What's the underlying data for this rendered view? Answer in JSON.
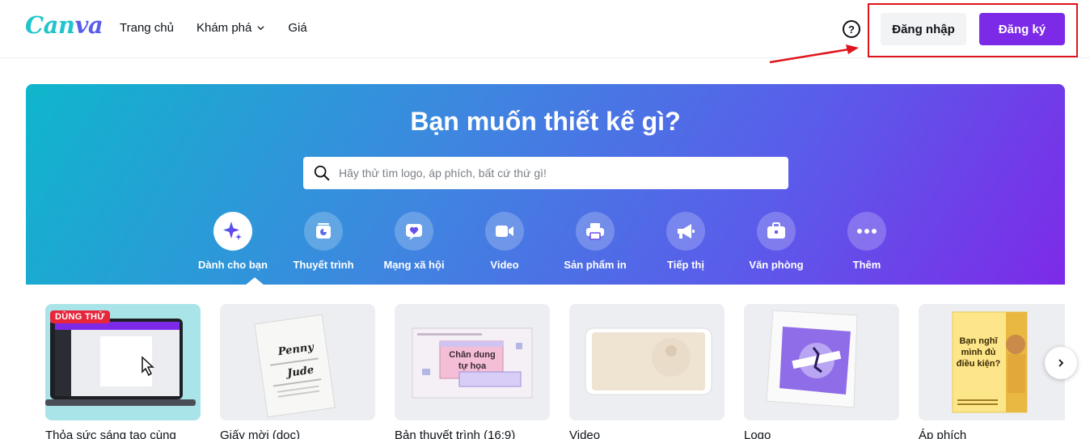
{
  "header": {
    "logo": "Canva",
    "nav": [
      {
        "label": "Trang chủ"
      },
      {
        "label": "Khám phá"
      },
      {
        "label": "Giá"
      }
    ],
    "help_icon": "question-circle-icon",
    "login_label": "Đăng nhập",
    "signup_label": "Đăng ký"
  },
  "hero": {
    "title": "Bạn muốn thiết kế gì?",
    "search_placeholder": "Hãy thử tìm logo, áp phích, bất cứ thứ gì!",
    "categories": [
      {
        "label": "Dành cho bạn",
        "icon": "sparkle-icon"
      },
      {
        "label": "Thuyết trình",
        "icon": "presentation-icon"
      },
      {
        "label": "Mạng xã hội",
        "icon": "heart-icon"
      },
      {
        "label": "Video",
        "icon": "video-camera-icon"
      },
      {
        "label": "Sản phẩm in",
        "icon": "printer-icon"
      },
      {
        "label": "Tiếp thị",
        "icon": "megaphone-icon"
      },
      {
        "label": "Văn phòng",
        "icon": "briefcase-icon"
      },
      {
        "label": "Thêm",
        "icon": "more-icon"
      }
    ]
  },
  "templates": [
    {
      "label": "Thỏa sức sáng tạo cùng",
      "badge": "DÙNG THỬ"
    },
    {
      "label": "Giấy mời (dọc)",
      "card_lines": [
        "Penny",
        "Jude"
      ]
    },
    {
      "label": "Bản thuyết trình (16:9)",
      "card_text": "Chân dung tự họa"
    },
    {
      "label": "Video"
    },
    {
      "label": "Logo"
    },
    {
      "label": "Áp phích",
      "card_text": "Bạn nghĩ mình đủ điều kiện?"
    }
  ],
  "colors": {
    "brand_purple": "#7d2ae8",
    "brand_teal": "#20c4cb",
    "annotation_red": "#e0141b"
  }
}
